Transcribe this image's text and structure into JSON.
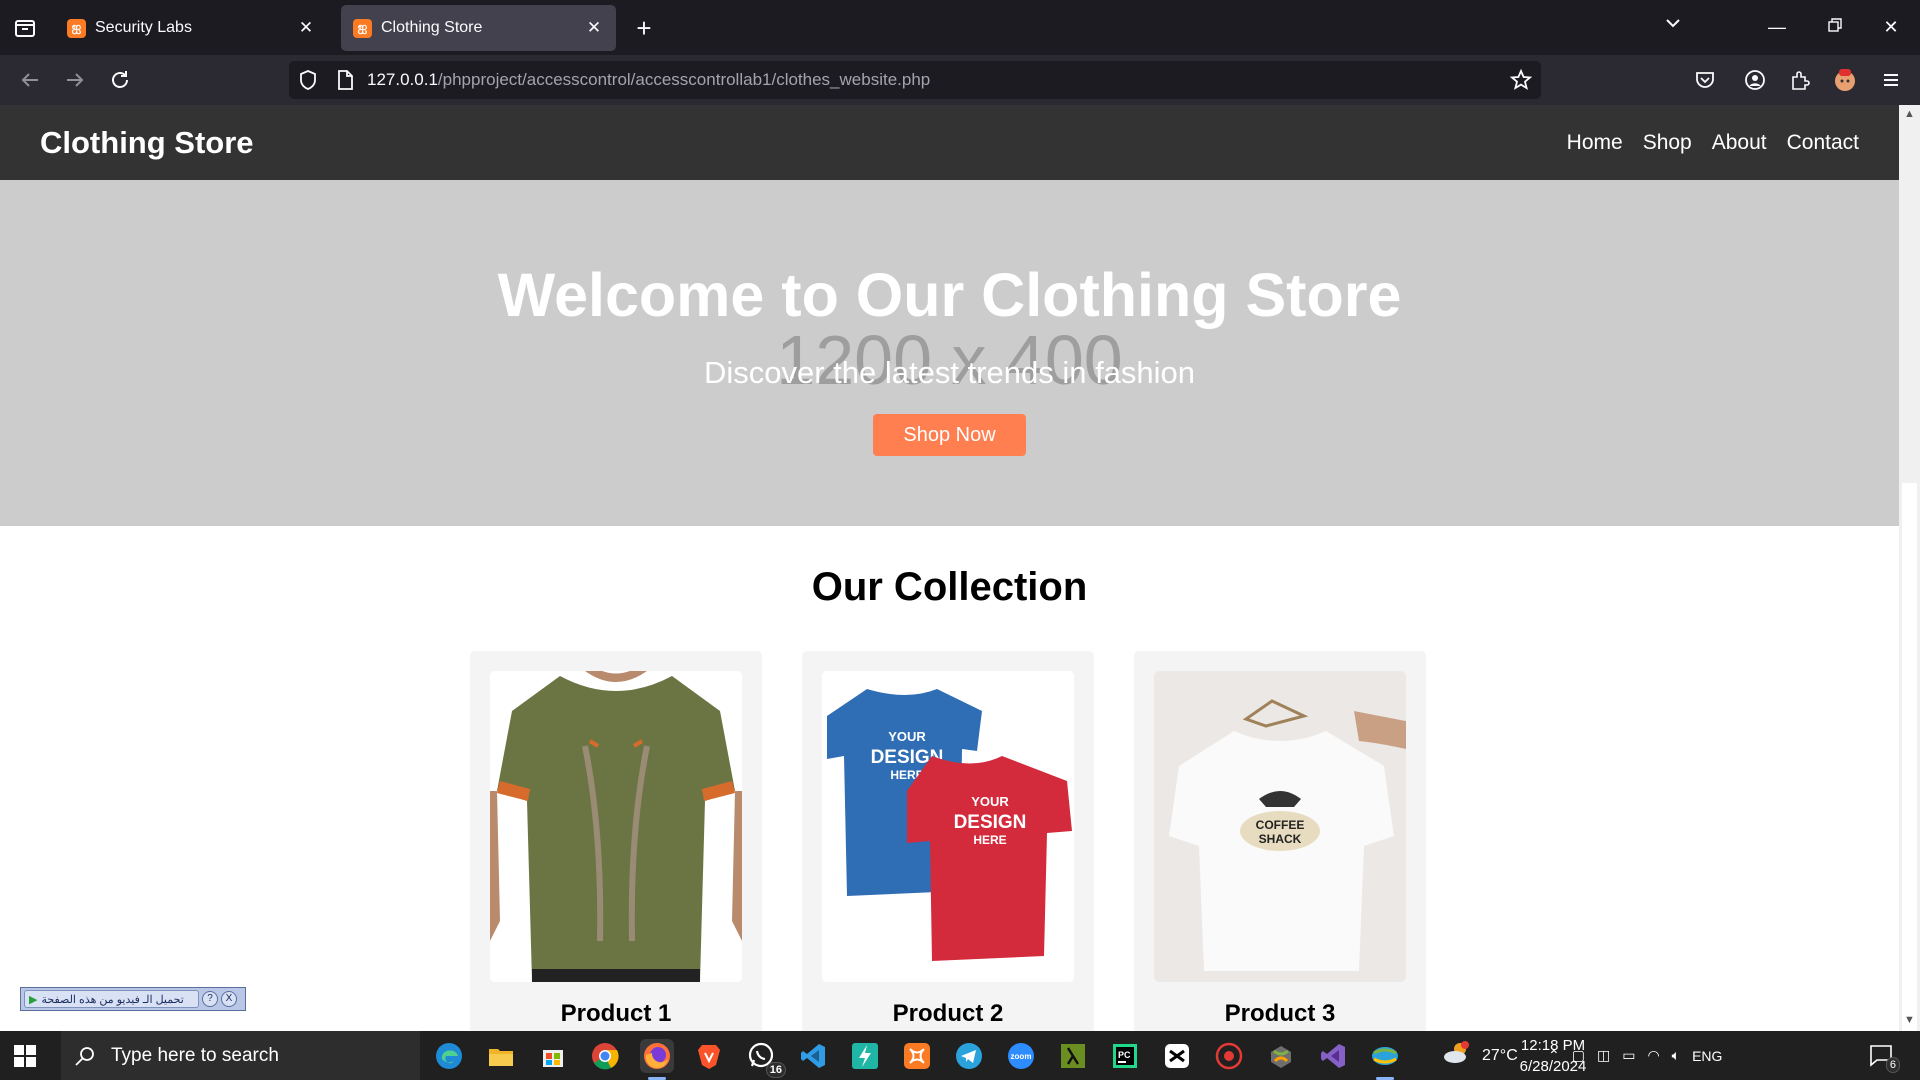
{
  "browser": {
    "tabs": [
      {
        "title": "Security Labs",
        "active": false
      },
      {
        "title": "Clothing Store",
        "active": true
      }
    ],
    "url_host": "127.0.0.1",
    "url_path": "/phpproject/accesscontrol/accesscontrollab1/clothes_website.php"
  },
  "site": {
    "logo": "Clothing Store",
    "nav": [
      "Home",
      "Shop",
      "About",
      "Contact"
    ],
    "hero": {
      "placeholder": "1200 x 400",
      "title": "Welcome to Our Clothing Store",
      "subtitle": "Discover the latest trends in fashion",
      "button": "Shop Now"
    },
    "collection_title": "Our Collection",
    "products": [
      {
        "name": "Product 1",
        "image_print": ""
      },
      {
        "name": "Product 2",
        "image_print": "YOUR DESIGN HERE"
      },
      {
        "name": "Product 3",
        "image_print": "COFFEE SHACK"
      }
    ]
  },
  "video_bar": {
    "label": "تحميل الـ فيديو من هذه الصفحة",
    "help": "?",
    "close": "X"
  },
  "taskbar": {
    "search_placeholder": "Type here to search",
    "whatsapp_badge": "16",
    "weather": "27°C",
    "language": "ENG",
    "time": "12:18 PM",
    "date": "6/28/2024",
    "notifications": "6"
  },
  "colors": {
    "accent": "#ff7f50",
    "header": "#333333",
    "hero_bg": "#cccccc"
  }
}
